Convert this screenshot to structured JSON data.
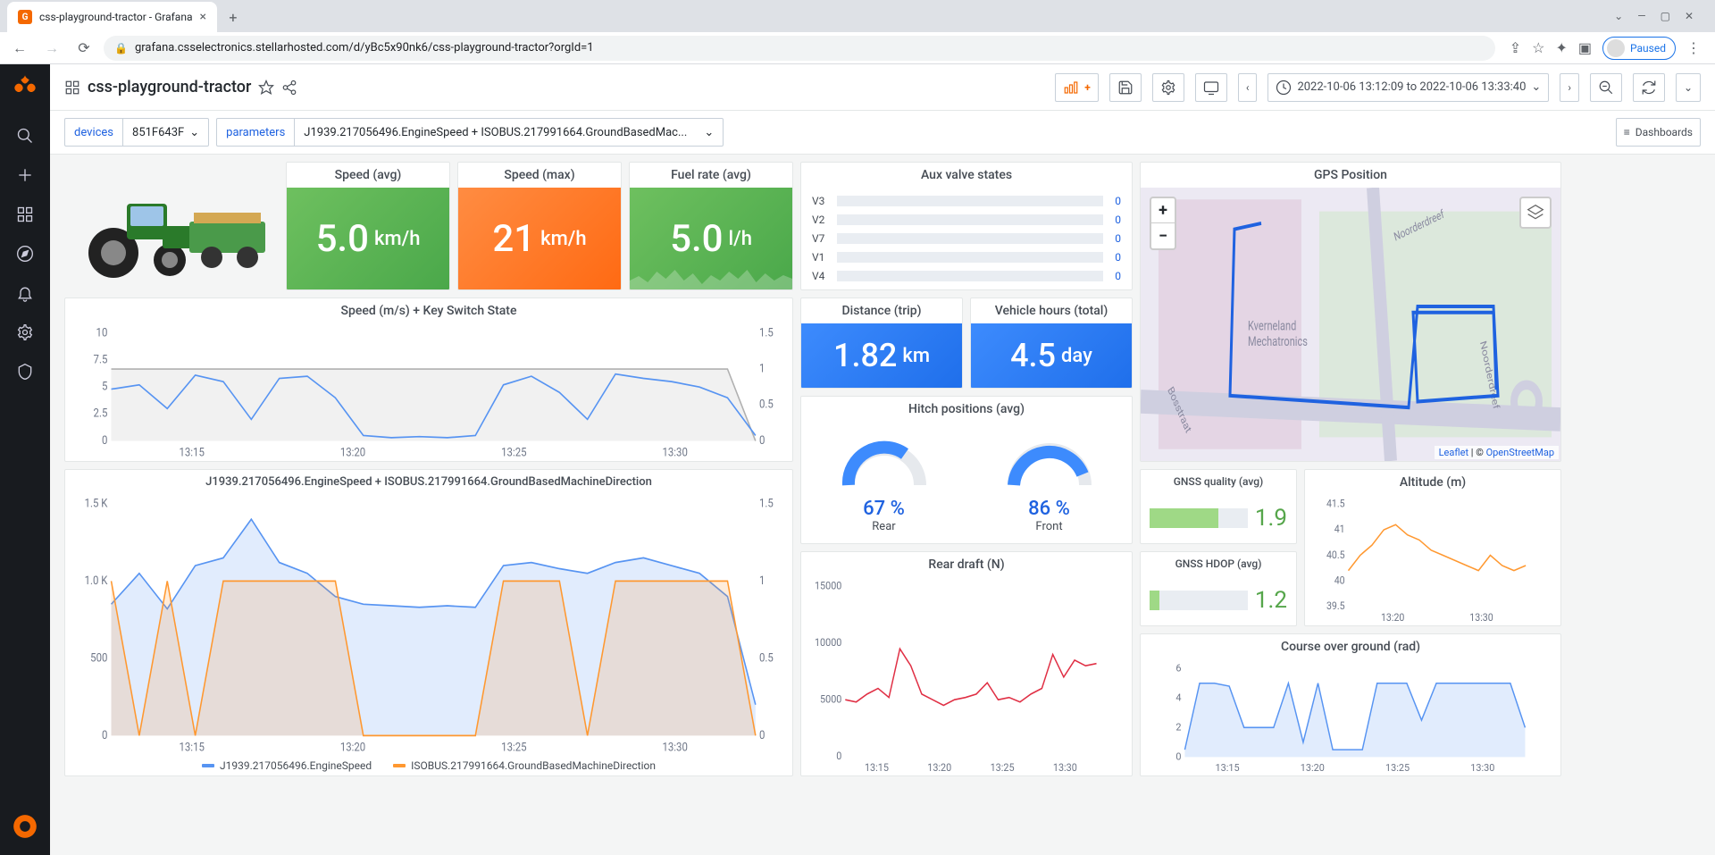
{
  "browser": {
    "tab_title": "css-playground-tractor - Grafana",
    "url": "grafana.csselectronics.stellarhosted.com/d/yBc5x90nk6/css-playground-tractor?orgId=1",
    "paused_label": "Paused"
  },
  "header": {
    "dashboard_title": "css-playground-tractor",
    "time_range": "2022-10-06 13:12:09 to 2022-10-06 13:33:40"
  },
  "vars": {
    "devices_label": "devices",
    "devices_value": "851F643F",
    "parameters_label": "parameters",
    "parameters_value": "J1939.217056496.EngineSpeed + ISOBUS.217991664.GroundBasedMac...",
    "dashboards_btn": "Dashboards"
  },
  "panels": {
    "speed_avg": {
      "title": "Speed (avg)",
      "value": "5.0",
      "unit": "km/h"
    },
    "speed_max": {
      "title": "Speed (max)",
      "value": "21",
      "unit": "km/h"
    },
    "fuel_rate": {
      "title": "Fuel rate (avg)",
      "value": "5.0",
      "unit": "l/h"
    },
    "aux_valve": {
      "title": "Aux valve states",
      "rows": [
        {
          "label": "V3",
          "value": "0"
        },
        {
          "label": "V2",
          "value": "0"
        },
        {
          "label": "V7",
          "value": "0"
        },
        {
          "label": "V1",
          "value": "0"
        },
        {
          "label": "V4",
          "value": "0"
        }
      ]
    },
    "gps": {
      "title": "GPS Position",
      "leaflet": "Leaflet",
      "osm": "OpenStreetMap"
    },
    "speed_chart": {
      "title": "Speed (m/s) + Key Switch State"
    },
    "distance": {
      "title": "Distance (trip)",
      "value": "1.82",
      "unit": "km"
    },
    "vehicle_hours": {
      "title": "Vehicle hours (total)",
      "value": "4.5",
      "unit": "day"
    },
    "hitch": {
      "title": "Hitch positions (avg)",
      "rear_val": "67 %",
      "rear_lbl": "Rear",
      "front_val": "86 %",
      "front_lbl": "Front"
    },
    "engine": {
      "title": "J1939.217056496.EngineSpeed + ISOBUS.217991664.GroundBasedMachineDirection",
      "legend1": "J1939.217056496.EngineSpeed",
      "legend2": "ISOBUS.217991664.GroundBasedMachineDirection"
    },
    "gnss_quality": {
      "title": "GNSS quality (avg)",
      "value": "1.9"
    },
    "gnss_hdop": {
      "title": "GNSS HDOP (avg)",
      "value": "1.2"
    },
    "altitude": {
      "title": "Altitude (m)"
    },
    "rear_draft": {
      "title": "Rear draft (N)"
    },
    "course": {
      "title": "Course over ground (rad)"
    }
  },
  "chart_data": {
    "speed_chart": {
      "type": "line",
      "x_ticks": [
        "13:15",
        "13:20",
        "13:25",
        "13:30"
      ],
      "series": [
        {
          "name": "Speed",
          "axis": "left",
          "color": "#5794f2",
          "y_ticks": [
            0,
            2.5,
            5.0,
            7.5,
            10.0
          ],
          "values": [
            4.8,
            5.2,
            3.0,
            6.1,
            5.5,
            2.0,
            5.8,
            6.0,
            4.0,
            0.5,
            0.3,
            0.4,
            0.3,
            0.5,
            5.2,
            6.0,
            4.5,
            2.0,
            6.2,
            5.8,
            5.5,
            5.0,
            4.0,
            0.5
          ]
        },
        {
          "name": "KeySwitch",
          "axis": "right",
          "color": "#c8c8c8",
          "y_ticks": [
            0,
            0.5,
            1.0,
            1.5
          ],
          "values": [
            1,
            1,
            1,
            1,
            1,
            1,
            1,
            1,
            1,
            1,
            1,
            1,
            1,
            1,
            1,
            1,
            1,
            1,
            1,
            1,
            1,
            1,
            1,
            0
          ]
        }
      ]
    },
    "engine_chart": {
      "type": "line",
      "x_ticks": [
        "13:15",
        "13:20",
        "13:25",
        "13:30"
      ],
      "series": [
        {
          "name": "EngineSpeed",
          "axis": "left",
          "color": "#5794f2",
          "y_ticks": [
            0,
            500,
            "1.0 K",
            "1.5 K"
          ],
          "values": [
            850,
            1050,
            820,
            1100,
            1150,
            1400,
            1120,
            1050,
            900,
            850,
            840,
            830,
            840,
            830,
            1100,
            1120,
            1080,
            1050,
            1120,
            1150,
            1100,
            1050,
            900,
            200
          ]
        },
        {
          "name": "GroundBasedMachineDirection",
          "axis": "right",
          "color": "#ff9830",
          "y_ticks": [
            0,
            0.5,
            1.0,
            1.5
          ],
          "values": [
            1,
            0,
            1,
            0,
            1,
            1,
            1,
            1,
            1,
            0,
            0,
            0,
            0,
            0,
            1,
            1,
            1,
            0,
            1,
            1,
            1,
            1,
            1,
            0
          ]
        }
      ]
    },
    "altitude_chart": {
      "type": "line",
      "color": "#ff9830",
      "x_ticks": [
        "13:20",
        "13:30"
      ],
      "y_ticks": [
        39.5,
        40.0,
        40.5,
        41.0,
        41.5
      ],
      "values": [
        40.2,
        40.5,
        40.7,
        41.0,
        41.1,
        40.9,
        40.8,
        40.6,
        40.5,
        40.4,
        40.3,
        40.2,
        40.5,
        40.3,
        40.2,
        40.3
      ]
    },
    "rear_draft_chart": {
      "type": "line",
      "color": "#e02f44",
      "x_ticks": [
        "13:15",
        "13:20",
        "13:25",
        "13:30"
      ],
      "y_ticks": [
        0,
        5000,
        10000,
        15000
      ],
      "values": [
        5000,
        4800,
        5500,
        6000,
        5200,
        9500,
        8000,
        5500,
        5000,
        4500,
        5000,
        5200,
        5500,
        6500,
        5000,
        5200,
        4800,
        5500,
        6000,
        9000,
        7000,
        8500,
        8000,
        8200
      ]
    },
    "course_chart": {
      "type": "area",
      "color": "#5794f2",
      "x_ticks": [
        "13:15",
        "13:20",
        "13:25",
        "13:30"
      ],
      "y_ticks": [
        0,
        2,
        4,
        6
      ],
      "values": [
        0.5,
        5.0,
        5.0,
        4.8,
        2.0,
        2.0,
        2.0,
        5.0,
        1.0,
        5.0,
        0.5,
        0.5,
        0.5,
        5.0,
        5.0,
        5.0,
        2.5,
        5.0,
        5.0,
        5.0,
        5.0,
        5.0,
        5.0,
        2.0
      ]
    }
  }
}
